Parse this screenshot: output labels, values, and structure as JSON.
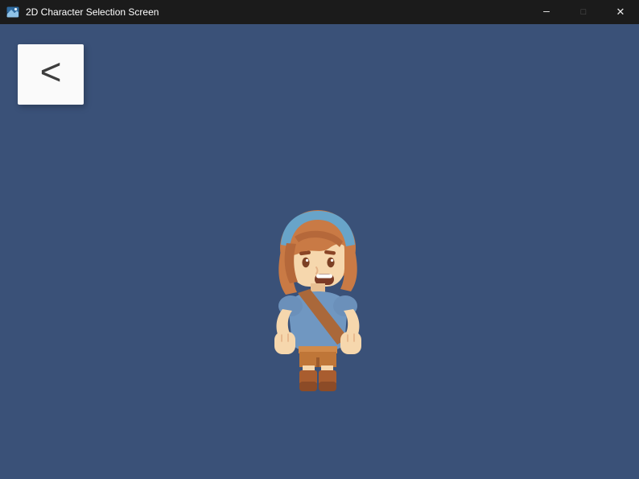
{
  "window": {
    "title": "2D Character Selection Screen",
    "controls": {
      "minimize": "–",
      "maximize": "□",
      "close": "✕"
    }
  },
  "colors": {
    "titlebar_bg": "#1b1b1b",
    "titlebar_text": "#ffffff",
    "body_bg": "#3a5178",
    "back_button_bg": "#fafafa",
    "back_button_text": "#3d3d3d",
    "hair": "#c97a45",
    "hair_dark": "#b5683a",
    "headband": "#68a4c9",
    "skin": "#f6d7ad",
    "shirt": "#7097c1",
    "strap": "#aa683a",
    "shorts": "#bf7638",
    "boots": "#a95d2f"
  },
  "back_button": {
    "label": "<"
  },
  "character": {
    "name": "girl-adventurer-sprite",
    "description": "2D girl character with orange hair, blue headband, blue tunic, diagonal shoulder strap and brown boots"
  },
  "app_icon": "window-app-icon"
}
